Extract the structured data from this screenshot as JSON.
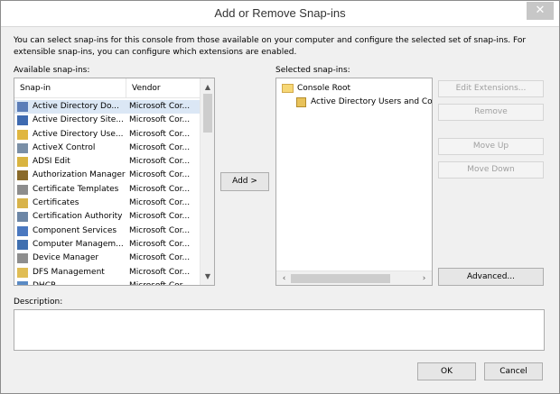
{
  "window": {
    "title": "Add or Remove Snap-ins",
    "close_glyph": "✕"
  },
  "description_text": "You can select snap-ins for this console from those available on your computer and configure the selected set of snap-ins. For extensible snap-ins, you can configure which extensions are enabled.",
  "available": {
    "label": "Available snap-ins:",
    "columns": {
      "snapin": "Snap-in",
      "vendor": "Vendor"
    },
    "rows": [
      {
        "name": "Active Directory Do...",
        "vendor": "Microsoft Cor...",
        "icon": "ad-domains-icon",
        "color": "#5b7db8"
      },
      {
        "name": "Active Directory Site...",
        "vendor": "Microsoft Cor...",
        "icon": "ad-sites-icon",
        "color": "#3e6ab0"
      },
      {
        "name": "Active Directory Use...",
        "vendor": "Microsoft Cor...",
        "icon": "ad-users-icon",
        "color": "#e0b640"
      },
      {
        "name": "ActiveX Control",
        "vendor": "Microsoft Cor...",
        "icon": "activex-icon",
        "color": "#7a8fa6"
      },
      {
        "name": "ADSI Edit",
        "vendor": "Microsoft Cor...",
        "icon": "adsi-edit-icon",
        "color": "#d9b440"
      },
      {
        "name": "Authorization Manager",
        "vendor": "Microsoft Cor...",
        "icon": "authorization-icon",
        "color": "#8a6a2a"
      },
      {
        "name": "Certificate Templates",
        "vendor": "Microsoft Cor...",
        "icon": "cert-templates-icon",
        "color": "#8d8d8d"
      },
      {
        "name": "Certificates",
        "vendor": "Microsoft Cor...",
        "icon": "certificates-icon",
        "color": "#d8b34a"
      },
      {
        "name": "Certification Authority",
        "vendor": "Microsoft Cor...",
        "icon": "cert-authority-icon",
        "color": "#6c86a6"
      },
      {
        "name": "Component Services",
        "vendor": "Microsoft Cor...",
        "icon": "component-services-icon",
        "color": "#4a78c0"
      },
      {
        "name": "Computer Managem...",
        "vendor": "Microsoft Cor...",
        "icon": "computer-mgmt-icon",
        "color": "#3f6fb0"
      },
      {
        "name": "Device Manager",
        "vendor": "Microsoft Cor...",
        "icon": "device-manager-icon",
        "color": "#8e8e8e"
      },
      {
        "name": "DFS Management",
        "vendor": "Microsoft Cor...",
        "icon": "dfs-icon",
        "color": "#e0bd55"
      },
      {
        "name": "DHCP",
        "vendor": "Microsoft Cor...",
        "icon": "dhcp-icon",
        "color": "#5a8ac4"
      }
    ]
  },
  "add_button": "Add >",
  "selected": {
    "label": "Selected snap-ins:",
    "tree": [
      {
        "label": "Console Root",
        "level": 0
      },
      {
        "label": "Active Directory Users and Com",
        "level": 1
      }
    ]
  },
  "buttons": {
    "edit_extensions": "Edit Extensions...",
    "remove": "Remove",
    "move_up": "Move Up",
    "move_down": "Move Down",
    "advanced": "Advanced...",
    "ok": "OK",
    "cancel": "Cancel"
  },
  "description_label": "Description:",
  "colors": {
    "selection": "#dbe7f5",
    "folder": "#f6d776",
    "titlebar_close": "#c7c7c7"
  }
}
